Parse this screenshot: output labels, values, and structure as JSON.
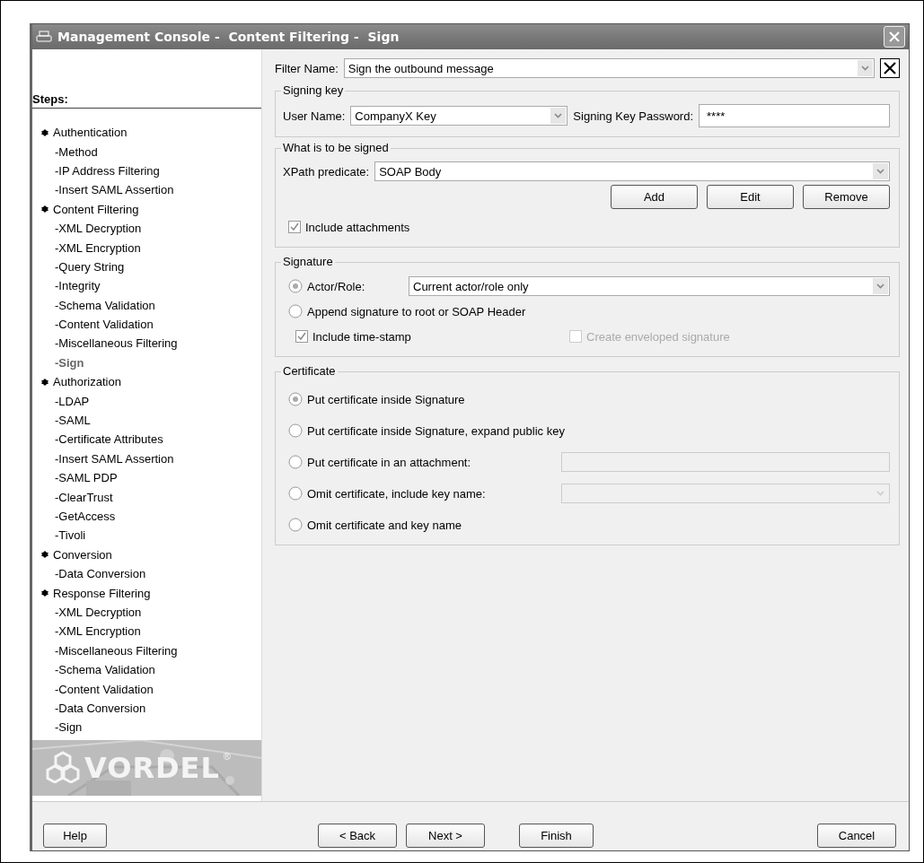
{
  "window": {
    "title": "Management Console -  Content Filtering -  Sign"
  },
  "sidebar": {
    "title": "Steps:",
    "items": [
      {
        "label": "Authentication",
        "selected": false,
        "children": [
          {
            "label": "-Method",
            "selected": false
          },
          {
            "label": "-IP Address Filtering",
            "selected": false
          },
          {
            "label": "-Insert SAML Assertion",
            "selected": false
          }
        ]
      },
      {
        "label": "Content Filtering",
        "selected": false,
        "children": [
          {
            "label": "-XML Decryption",
            "selected": false
          },
          {
            "label": "-XML Encryption",
            "selected": false
          },
          {
            "label": "-Query String",
            "selected": false
          },
          {
            "label": "-Integrity",
            "selected": false
          },
          {
            "label": "-Schema Validation",
            "selected": false
          },
          {
            "label": "-Content Validation",
            "selected": false
          },
          {
            "label": "-Miscellaneous Filtering",
            "selected": false
          },
          {
            "label": "-Sign",
            "selected": true
          }
        ]
      },
      {
        "label": "Authorization",
        "selected": false,
        "children": [
          {
            "label": "-LDAP",
            "selected": false
          },
          {
            "label": "-SAML",
            "selected": false
          },
          {
            "label": "-Certificate Attributes",
            "selected": false
          },
          {
            "label": "-Insert SAML Assertion",
            "selected": false
          },
          {
            "label": "-SAML PDP",
            "selected": false
          },
          {
            "label": "-ClearTrust",
            "selected": false
          },
          {
            "label": "-GetAccess",
            "selected": false
          },
          {
            "label": "-Tivoli",
            "selected": false
          }
        ]
      },
      {
        "label": "Conversion",
        "selected": false,
        "children": [
          {
            "label": "-Data Conversion",
            "selected": false
          }
        ]
      },
      {
        "label": "Response Filtering",
        "selected": false,
        "children": [
          {
            "label": "-XML Decryption",
            "selected": false
          },
          {
            "label": "-XML Encryption",
            "selected": false
          },
          {
            "label": "-Miscellaneous Filtering",
            "selected": false
          },
          {
            "label": "-Schema Validation",
            "selected": false
          },
          {
            "label": "-Content Validation",
            "selected": false
          },
          {
            "label": "-Data Conversion",
            "selected": false
          },
          {
            "label": "-Sign",
            "selected": false
          }
        ]
      }
    ],
    "logo": {
      "text": "VORDEL",
      "mark": "®"
    }
  },
  "filter_name": {
    "label": "Filter Name:",
    "value": "Sign the outbound message"
  },
  "signing_key": {
    "title": "Signing key",
    "user_label": "User Name:",
    "user_value": "CompanyX Key",
    "password_label": "Signing Key Password:",
    "password_value": "****"
  },
  "what_signed": {
    "title": "What is to be signed",
    "xpath_label": "XPath predicate:",
    "xpath_value": "SOAP Body",
    "buttons": [
      "Add",
      "Edit",
      "Remove"
    ],
    "include_attachments": {
      "label": "Include attachments",
      "checked": true
    }
  },
  "signature": {
    "title": "Signature",
    "options": [
      {
        "label": "Actor/Role:",
        "selected": true,
        "value": "Current actor/role only"
      },
      {
        "label": "Append signature to root or SOAP Header",
        "selected": false
      }
    ],
    "checks": [
      {
        "label": "Include time-stamp",
        "checked": true,
        "disabled": false
      },
      {
        "label": "Create enveloped signature",
        "checked": false,
        "disabled": true
      }
    ]
  },
  "certificate": {
    "title": "Certificate",
    "options": [
      {
        "label": "Put certificate inside Signature",
        "selected": true,
        "kind": "plain"
      },
      {
        "label": "Put certificate inside Signature, expand public key",
        "selected": false,
        "kind": "plain"
      },
      {
        "label": "Put certificate in an attachment:",
        "selected": false,
        "kind": "field"
      },
      {
        "label": "Omit certificate, include key name:",
        "selected": false,
        "kind": "dropdown"
      },
      {
        "label": "Omit certificate and key name",
        "selected": false,
        "kind": "plain"
      }
    ]
  },
  "footer": {
    "help": "Help",
    "nav": [
      "< Back",
      "Next >"
    ],
    "finish": "Finish",
    "cancel": "Cancel"
  }
}
